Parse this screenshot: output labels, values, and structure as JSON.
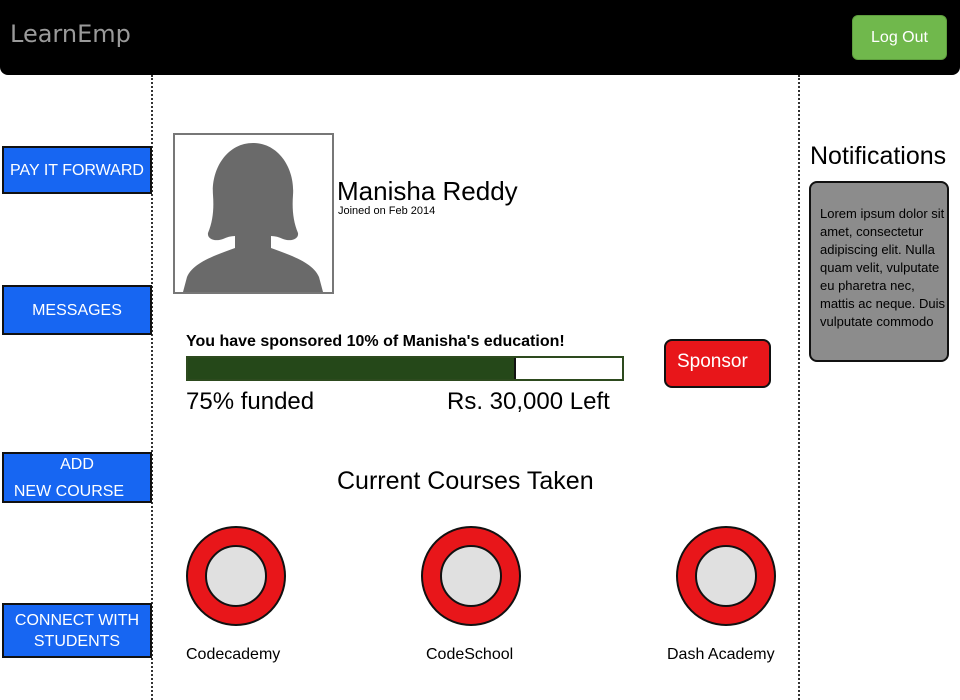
{
  "app": {
    "title": "LearnEmp",
    "logout_label": "Log Out"
  },
  "sidebar": {
    "items": [
      {
        "line1": "PAY IT FORWARD",
        "line2": ""
      },
      {
        "line1": "MESSAGES",
        "line2": ""
      },
      {
        "line1": "ADD",
        "line2": "NEW COURSE"
      },
      {
        "line1": "CONNECT WITH",
        "line2": "STUDENTS"
      }
    ]
  },
  "profile": {
    "name": "Manisha Reddy",
    "joined": "Joined on Feb 2014"
  },
  "funding": {
    "message": "You have sponsored 10% of Manisha's education!",
    "percent_funded": 75,
    "funded_label": "75% funded",
    "left_label": "Rs. 30,000 Left",
    "sponsor_label": "Sponsor"
  },
  "courses": {
    "title": "Current Courses Taken",
    "items": [
      {
        "name": "Codecademy"
      },
      {
        "name": "CodeSchool"
      },
      {
        "name": "Dash Academy"
      }
    ]
  },
  "notifications": {
    "title": "Notifications",
    "text": "Lorem ipsum dolor sit amet, consectetur adipiscing elit. Nulla quam velit, vulputate eu pharetra nec, mattis ac neque. Duis vulputate commodo"
  },
  "colors": {
    "topbar": "#000000",
    "logout": "#70b84c",
    "nav": "#1766f2",
    "progress_fill": "#254819",
    "sponsor": "#e8161a",
    "ring": "#e8161a",
    "notif_bg": "#8c8c8c"
  }
}
